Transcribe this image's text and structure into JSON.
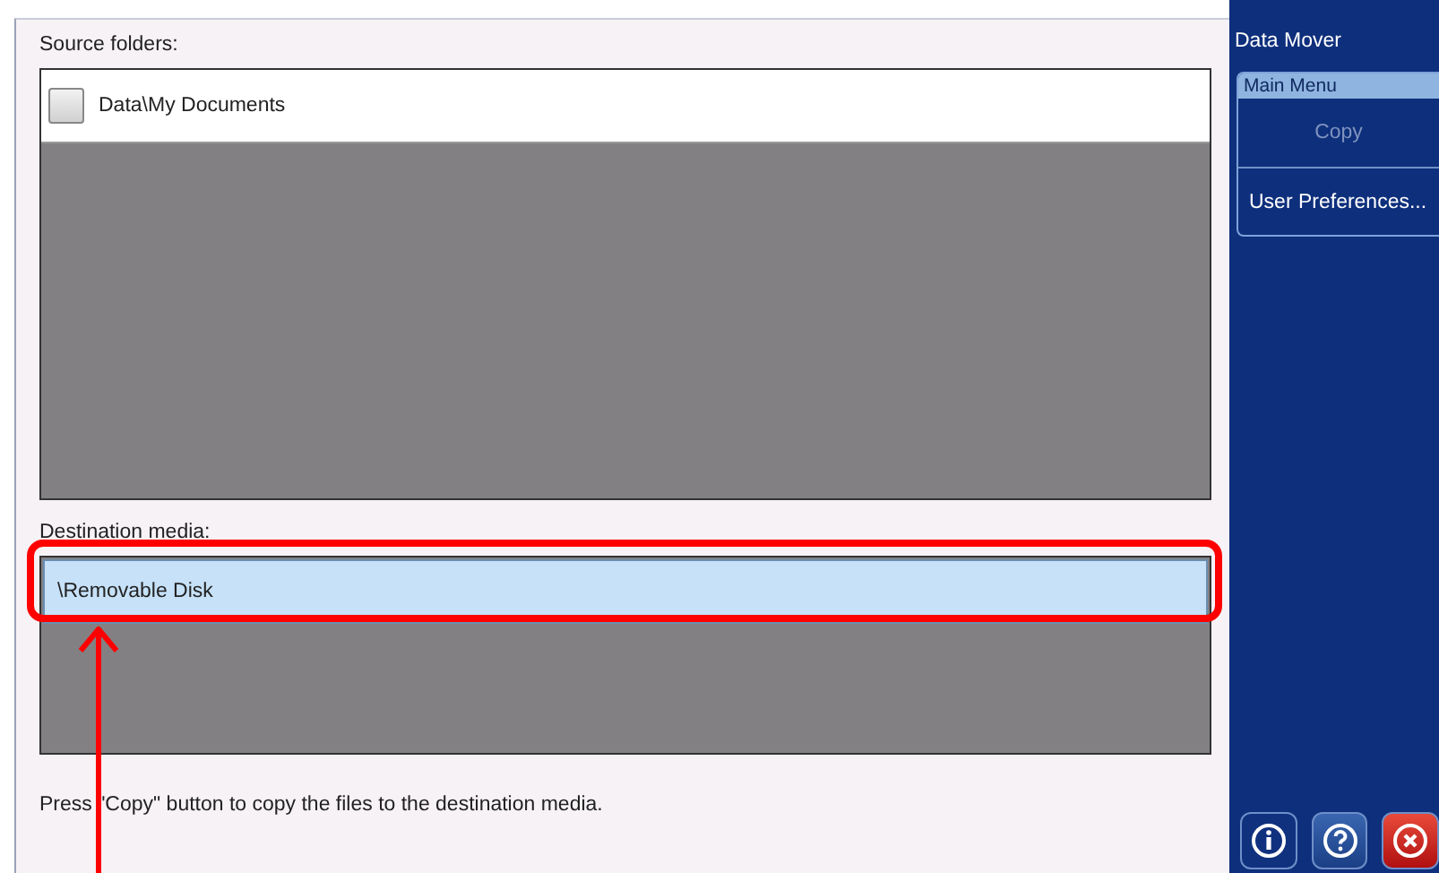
{
  "source_folders": {
    "label": "Source folders:",
    "items": [
      {
        "name": "Data\\My Documents",
        "checked": false
      }
    ]
  },
  "destination_media": {
    "label": "Destination media:",
    "items": [
      {
        "name": "\\Removable Disk",
        "selected": true
      }
    ]
  },
  "message": "Press \"Copy\" button to copy the files to the destination media.",
  "sidebar": {
    "title": "Data Mover",
    "menu_title": "Main Menu",
    "items": [
      {
        "label": "Copy",
        "disabled": true
      },
      {
        "label": "User Preferences...",
        "disabled": false
      }
    ]
  },
  "footer_buttons": [
    {
      "kind": "info"
    },
    {
      "kind": "help"
    },
    {
      "kind": "close"
    }
  ]
}
